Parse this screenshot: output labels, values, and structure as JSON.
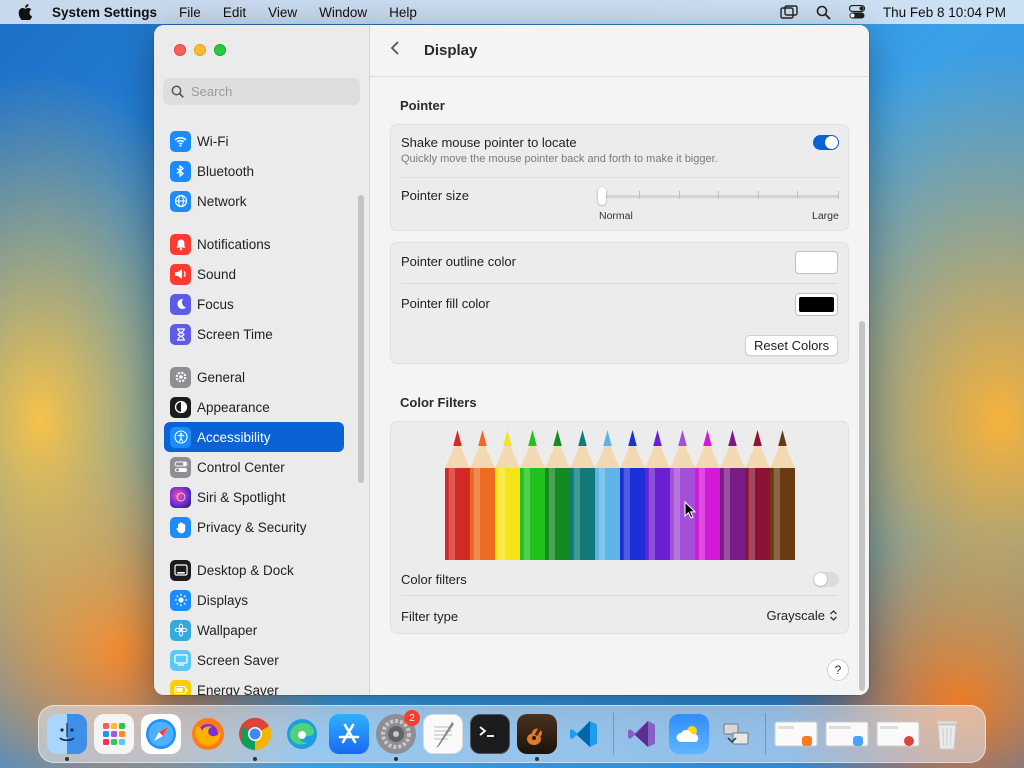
{
  "menubar": {
    "app_name": "System Settings",
    "menus": [
      "File",
      "Edit",
      "View",
      "Window",
      "Help"
    ],
    "clock": "Thu Feb 8  10:04 PM"
  },
  "sidebar": {
    "search_placeholder": "Search",
    "items": [
      {
        "label": "Wi-Fi",
        "icon": "wifi-icon",
        "color": "#1a8cff"
      },
      {
        "label": "Bluetooth",
        "icon": "bluetooth-icon",
        "color": "#1a8cff"
      },
      {
        "label": "Network",
        "icon": "globe-icon",
        "color": "#1a8cff"
      },
      {
        "label": "Notifications",
        "icon": "bell-icon",
        "color": "#fe3b30"
      },
      {
        "label": "Sound",
        "icon": "speaker-icon",
        "color": "#fe3b30"
      },
      {
        "label": "Focus",
        "icon": "moon-icon",
        "color": "#5e5ce6"
      },
      {
        "label": "Screen Time",
        "icon": "hourglass-icon",
        "color": "#5e5ce6"
      },
      {
        "label": "General",
        "icon": "gear-icon",
        "color": "#8e8e93"
      },
      {
        "label": "Appearance",
        "icon": "appearance-icon",
        "color": "#1c1c1e"
      },
      {
        "label": "Accessibility",
        "icon": "accessibility-icon",
        "color": "#1a8cff"
      },
      {
        "label": "Control Center",
        "icon": "toggles-icon",
        "color": "#8e8e93"
      },
      {
        "label": "Siri & Spotlight",
        "icon": "siri-icon",
        "color": "#8a3ffc"
      },
      {
        "label": "Privacy & Security",
        "icon": "hand-icon",
        "color": "#1a8cff"
      },
      {
        "label": "Desktop & Dock",
        "icon": "dock-icon",
        "color": "#1c1c1e"
      },
      {
        "label": "Displays",
        "icon": "sun-icon",
        "color": "#1a8cff"
      },
      {
        "label": "Wallpaper",
        "icon": "flower-icon",
        "color": "#34aadc"
      },
      {
        "label": "Screen Saver",
        "icon": "screensaver-icon",
        "color": "#5ac8fa"
      },
      {
        "label": "Energy Saver",
        "icon": "battery-icon",
        "color": "#ffcc00"
      }
    ],
    "active": "Accessibility"
  },
  "content": {
    "title": "Display",
    "pointer": {
      "section_title": "Pointer",
      "shake_label": "Shake mouse pointer to locate",
      "shake_sub": "Quickly move the mouse pointer back and forth to make it bigger.",
      "shake_on": true,
      "size_label": "Pointer size",
      "size_min": "Normal",
      "size_max": "Large",
      "size_value": 0,
      "outline_label": "Pointer outline color",
      "outline_color": "#ffffff",
      "fill_label": "Pointer fill color",
      "fill_color": "#000000",
      "reset_label": "Reset Colors"
    },
    "color_filters": {
      "section_title": "Color Filters",
      "toggle_label": "Color filters",
      "toggle_on": false,
      "type_label": "Filter type",
      "type_value": "Grayscale",
      "pencil_colors": [
        "#d42a26",
        "#ee6a22",
        "#f5e41a",
        "#22c21e",
        "#138a22",
        "#0f7a78",
        "#5fb4e6",
        "#1b2fd8",
        "#6a1fd0",
        "#a44fd8",
        "#d21ad8",
        "#7a1c86",
        "#8c1238",
        "#6a3a12"
      ]
    },
    "help": "?"
  },
  "dock": {
    "apps": [
      {
        "name": "finder-icon",
        "color": "#4aa3ff",
        "running": true
      },
      {
        "name": "launchpad-icon",
        "color": "#f0f0f0",
        "running": false
      },
      {
        "name": "safari-icon",
        "color": "#1e90ff",
        "running": false
      },
      {
        "name": "firefox-icon",
        "color": "#ff7a1a",
        "running": false
      },
      {
        "name": "chrome-icon",
        "color": "#ffffff",
        "running": true
      },
      {
        "name": "edge-icon",
        "color": "#1aa0e0",
        "running": false
      },
      {
        "name": "app-store-icon",
        "color": "#2f8dfc",
        "running": false
      },
      {
        "name": "system-settings-icon",
        "color": "#8e8e93",
        "running": true,
        "badge": "2"
      },
      {
        "name": "textedit-icon",
        "color": "#f2f2f2",
        "running": false
      },
      {
        "name": "terminal-icon",
        "color": "#1c1c1e",
        "running": false
      },
      {
        "name": "garageband-icon",
        "color": "#e07a2a",
        "running": true
      },
      {
        "name": "vscode-icon",
        "color": "#ffffff",
        "running": false
      },
      {
        "name": "visual-studio-icon",
        "color": "#ffffff",
        "running": false
      },
      {
        "name": "weather-icon",
        "color": "#2f8dfc",
        "running": false
      },
      {
        "name": "migration-assistant-icon",
        "color": "#e8e8e8",
        "running": false
      }
    ],
    "recents": [
      "recent-window-1",
      "recent-window-2",
      "recent-window-3"
    ],
    "trash": "trash-icon"
  }
}
